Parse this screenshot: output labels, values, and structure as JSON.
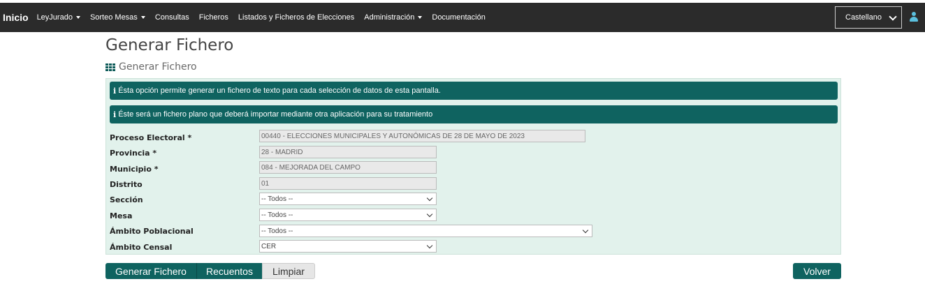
{
  "nav": {
    "brand": "Inicio",
    "items": [
      {
        "label": "LeyJurado",
        "dropdown": true
      },
      {
        "label": "Sorteo Mesas",
        "dropdown": true
      },
      {
        "label": "Consultas",
        "dropdown": false
      },
      {
        "label": "Ficheros",
        "dropdown": false
      },
      {
        "label": "Listados y Ficheros de Elecciones",
        "dropdown": false
      },
      {
        "label": "Administración",
        "dropdown": true
      },
      {
        "label": "Documentación",
        "dropdown": false
      }
    ],
    "language": "Castellano"
  },
  "page": {
    "title": "Generar Fichero",
    "subtitle": "Generar Fichero"
  },
  "alerts": [
    "Ésta opción permite generar un fichero de texto para cada selección de datos de esta pantalla.",
    "Éste será un fichero plano que deberá importar mediante otra aplicación para su tratamiento"
  ],
  "form": {
    "proceso": {
      "label": "Proceso Electoral *",
      "value": "00440 - ELECCIONES MUNICIPALES Y AUTONÓMICAS DE 28 DE MAYO DE 2023"
    },
    "provincia": {
      "label": "Provincia *",
      "value": "28 - MADRID"
    },
    "municipio": {
      "label": "Municipio *",
      "value": "084 - MEJORADA DEL CAMPO"
    },
    "distrito": {
      "label": "Distrito",
      "value": "01"
    },
    "seccion": {
      "label": "Sección",
      "value": "-- Todos --"
    },
    "mesa": {
      "label": "Mesa",
      "value": "-- Todos --"
    },
    "ambito_poblacional": {
      "label": "Ámbito Poblacional",
      "value": "-- Todos --"
    },
    "ambito_censal": {
      "label": "Ámbito Censal",
      "value": "CER"
    }
  },
  "buttons": {
    "generar": "Generar Fichero",
    "recuentos": "Recuentos",
    "limpiar": "Limpiar",
    "volver": "Volver"
  },
  "colors": {
    "navbar": "#2b2b2b",
    "accent": "#0f6360",
    "panel": "#e2f2ec"
  }
}
